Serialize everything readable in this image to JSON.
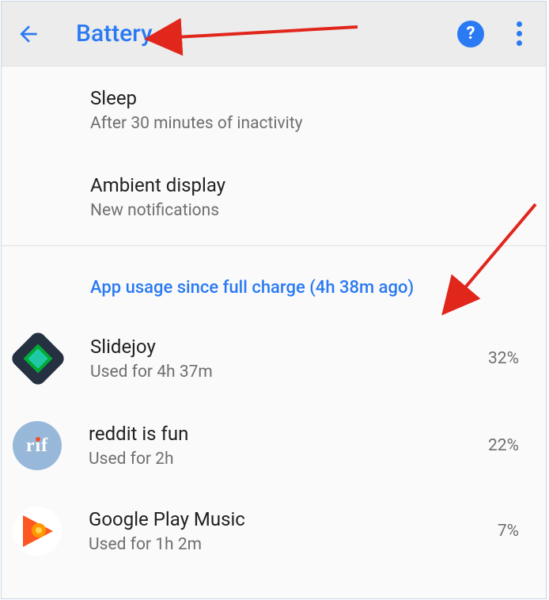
{
  "appbar": {
    "title": "Battery"
  },
  "settings": [
    {
      "title": "Sleep",
      "subtitle": "After 30 minutes of inactivity"
    },
    {
      "title": "Ambient display",
      "subtitle": "New notifications"
    }
  ],
  "section_header": "App usage since full charge (4h 38m ago)",
  "apps": [
    {
      "name": "Slidejoy",
      "usage": "Used for 4h 37m",
      "pct": "32%"
    },
    {
      "name": "reddit is fun",
      "usage": "Used for 2h",
      "pct": "22%"
    },
    {
      "name": "Google Play Music",
      "usage": "Used for 1h 2m",
      "pct": "7%"
    }
  ]
}
